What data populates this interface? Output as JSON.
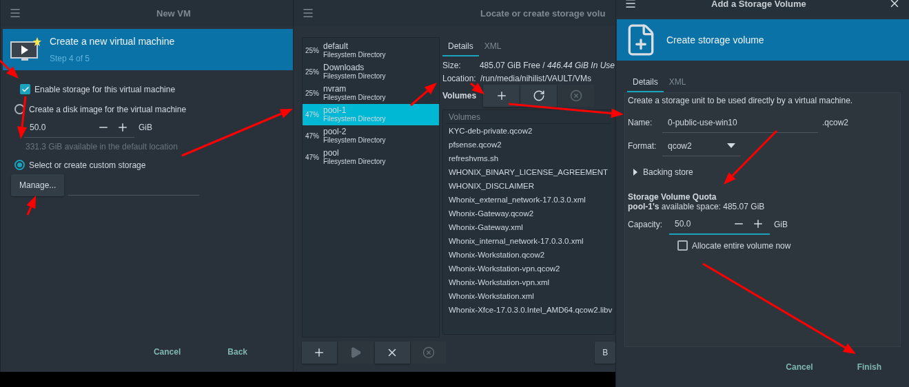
{
  "new_vm": {
    "title": "New VM",
    "header": {
      "title": "Create a new virtual machine",
      "subtitle": "Step 4 of 5"
    },
    "enable_storage": {
      "label": "Enable storage for this virtual machine",
      "checked": true
    },
    "storage_options": [
      {
        "label": "Create a disk image for the virtual machine",
        "selected": false
      },
      {
        "label": "Select or create custom storage",
        "selected": true
      }
    ],
    "disk_size": {
      "value": "50.0",
      "unit": "GiB"
    },
    "available_hint": "331.3 GiB available in the default location",
    "manage_button": "Manage...",
    "buttons": [
      "Cancel",
      "Back"
    ]
  },
  "storage_browser": {
    "title": "Locate or create storage volu",
    "pools": [
      {
        "percent": "25%",
        "name": "default",
        "type": "Filesystem Directory",
        "selected": false
      },
      {
        "percent": "25%",
        "name": "Downloads",
        "type": "Filesystem Directory",
        "selected": false
      },
      {
        "percent": "25%",
        "name": "nvram",
        "type": "Filesystem Directory",
        "selected": false
      },
      {
        "percent": "47%",
        "name": "pool-1",
        "type": "Filesystem Directory",
        "selected": true
      },
      {
        "percent": "47%",
        "name": "pool-2",
        "type": "Filesystem Directory",
        "selected": false
      },
      {
        "percent": "47%",
        "name": "pool",
        "type": "Filesystem Directory",
        "selected": false
      }
    ],
    "tabs": [
      {
        "label": "Details",
        "selected": true
      },
      {
        "label": "XML",
        "selected": false
      }
    ],
    "size": {
      "label": "Size:",
      "value": "485.07 GiB Free / *446.44 GiB In Use*"
    },
    "location": {
      "label": "Location:",
      "value": "/run/media/nihilist/VAULT/VMs"
    },
    "volumes_label": "Volumes",
    "volume_tools": [
      {
        "kind": "add",
        "disabled": false
      },
      {
        "kind": "refresh",
        "disabled": false
      },
      {
        "kind": "delete",
        "disabled": true
      }
    ],
    "volumes_column": "Volumes",
    "volumes": [
      "KYC-deb-private.qcow2",
      "pfsense.qcow2",
      "refreshvms.sh",
      "WHONIX_BINARY_LICENSE_AGREEMENT",
      "WHONIX_DISCLAIMER",
      "Whonix_external_network-17.0.3.0.xml",
      "Whonix-Gateway.qcow2",
      "Whonix-Gateway.xml",
      "Whonix_internal_network-17.0.3.0.xml",
      "Whonix-Workstation.qcow2",
      "Whonix-Workstation-vpn.qcow2",
      "Whonix-Workstation-vpn.xml",
      "Whonix-Workstation.xml",
      "Whonix-Xfce-17.0.3.0.Intel_AMD64.qcow2.libv"
    ],
    "pool_tools": [
      {
        "kind": "add",
        "disabled": false
      },
      {
        "kind": "start",
        "disabled": true
      },
      {
        "kind": "stop",
        "disabled": false
      },
      {
        "kind": "delete",
        "disabled": true
      }
    ],
    "cut_button": "B"
  },
  "add_volume": {
    "title": "Add a Storage Volume",
    "header": "Create storage volume",
    "tabs": [
      {
        "label": "Details",
        "selected": true
      },
      {
        "label": "XML",
        "selected": false
      }
    ],
    "description": "Create a storage unit to be used directly by a virtual machine.",
    "name": {
      "label": "Name:",
      "value": "0-public-use-win10",
      "suffix": ".qcow2"
    },
    "format": {
      "label": "Format:",
      "value": "qcow2"
    },
    "backing_store": {
      "label": "Backing store",
      "expanded": false
    },
    "quota_title": "Storage Volume Quota",
    "quota_available": "**pool-1's** available space: 485.07 GiB",
    "capacity": {
      "label": "Capacity:",
      "value": "50.0",
      "unit": "GiB"
    },
    "allocate": {
      "label": "Allocate entire volume now",
      "checked": false
    },
    "buttons": [
      "Cancel",
      "Finish"
    ]
  }
}
